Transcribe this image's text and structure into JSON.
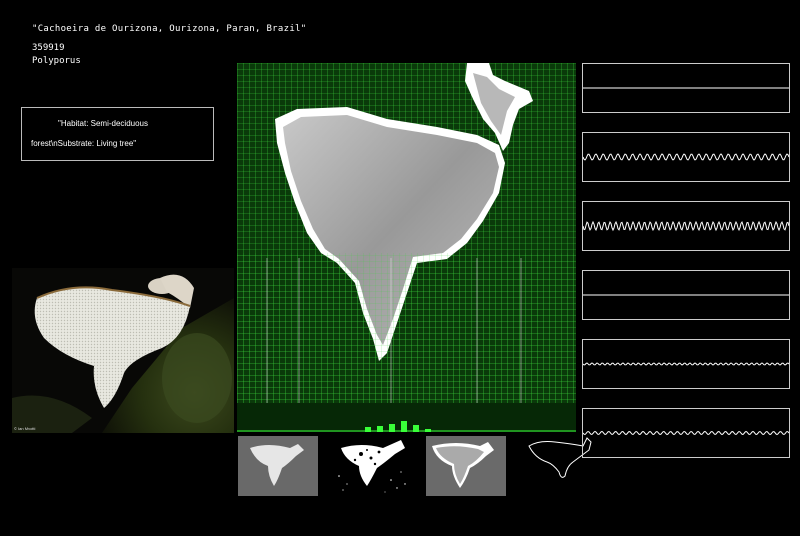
{
  "specimen": {
    "location": "\"Cachoeira de Ourizona, Ourizona, Paran, Brazil\"",
    "catalog_id": "359919",
    "genus": "Polyporus"
  },
  "habitat": {
    "line1": "\"Habitat: Semi-deciduous",
    "line2": "forest\\nSubstrate: Living tree\""
  },
  "photo": {
    "credit": "© Ian Mvotti"
  },
  "colors": {
    "grid_background": "#0a3a0a",
    "grid_lines": "#3bd43b",
    "histogram_green": "#39ff39",
    "panel_border": "#cccccc"
  },
  "signals": [
    {
      "amplitude": 0,
      "cycles": 0
    },
    {
      "amplitude": 3,
      "cycles": 28
    },
    {
      "amplitude": 4,
      "cycles": 36
    },
    {
      "amplitude": 0,
      "cycles": 0
    },
    {
      "amplitude": 1,
      "cycles": 40
    },
    {
      "amplitude": 1.5,
      "cycles": 30
    }
  ]
}
